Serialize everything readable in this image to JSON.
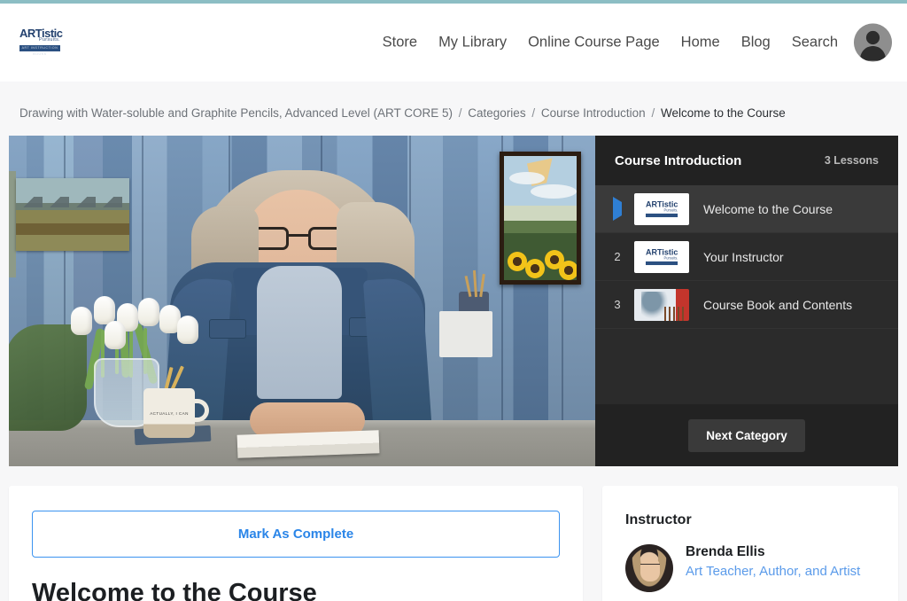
{
  "header": {
    "logo": {
      "name": "ARTistic Pursuits",
      "top": "ARTistic",
      "sub": "Pursuits.",
      "bar_text": "ART INSTRUCTION BOOKS"
    },
    "nav": [
      {
        "label": "Store",
        "name": "nav-store"
      },
      {
        "label": "My Library",
        "name": "nav-my-library"
      },
      {
        "label": "Online Course Page",
        "name": "nav-online-course-page"
      },
      {
        "label": "Home",
        "name": "nav-home"
      },
      {
        "label": "Blog",
        "name": "nav-blog"
      },
      {
        "label": "Search",
        "name": "nav-search"
      }
    ],
    "avatar_alt": "User account avatar",
    "accent_color": "#8cbec4"
  },
  "breadcrumb": {
    "course": "Drawing with Water-soluble and Graphite Pencils, Advanced Level (ART CORE 5)",
    "sep": "/",
    "categories": "Categories",
    "category": "Course Introduction",
    "current": "Welcome to the Course"
  },
  "video": {
    "description": "Instructor seated at a table in front of a blue painted plank wall, with white tulips in a glass vase, a ceramic mug of pencils, an open sketchbook, a landscape painting and a framed sunflower painting.",
    "mug_text": "ACTUALLY, I CAN"
  },
  "lesson_panel": {
    "title": "Course Introduction",
    "lesson_count": "3 Lessons",
    "next_button": "Next Category",
    "lessons": [
      {
        "index": "",
        "label": "Welcome to the Course",
        "active": true,
        "thumb": "logo"
      },
      {
        "index": "2",
        "label": "Your Instructor",
        "active": false,
        "thumb": "logo"
      },
      {
        "index": "3",
        "label": "Course Book and Contents",
        "active": false,
        "thumb": "book"
      }
    ],
    "play_icon_color": "#2f7fd4"
  },
  "main_card": {
    "mark_complete": "Mark As Complete",
    "lesson_heading": "Welcome to the Course",
    "button_color": "#2a85e8"
  },
  "sidebar_card": {
    "title": "Instructor",
    "instructor_name": "Brenda Ellis",
    "instructor_role": "Art Teacher, Author, and Artist",
    "role_color": "#5b9bea"
  }
}
